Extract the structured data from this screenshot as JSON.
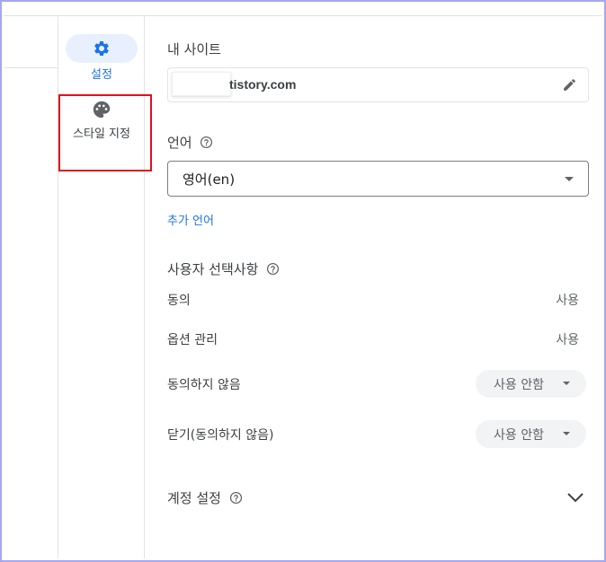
{
  "nav": {
    "settings_label": "설정",
    "style_label": "스타일 지정"
  },
  "my_site": {
    "title": "내 사이트",
    "url_suffix": "tistory.com"
  },
  "language": {
    "title": "언어",
    "selected": "영어(en)",
    "add_language": "추가 언어"
  },
  "user_choices": {
    "title": "사용자 선택사항",
    "rows": [
      {
        "label": "동의",
        "value": "사용"
      },
      {
        "label": "옵션 관리",
        "value": "사용"
      },
      {
        "label": "동의하지 않음",
        "value": "사용 안함"
      },
      {
        "label": "닫기(동의하지 않음)",
        "value": "사용 안함"
      }
    ]
  },
  "account": {
    "title": "계정 설정"
  },
  "colors": {
    "accent": "#1a73e8",
    "highlight": "#e0101b",
    "frame": "#a6a6f0"
  }
}
